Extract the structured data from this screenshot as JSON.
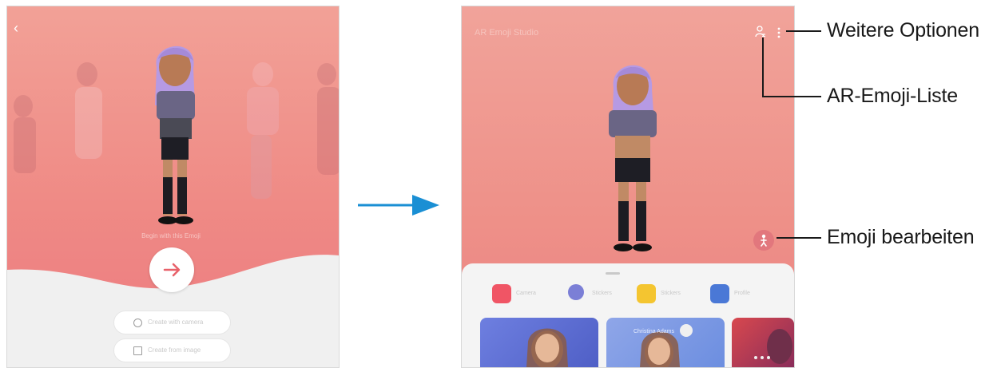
{
  "left_screen": {
    "back_label": "‹",
    "caption": "Begin with this Emoji",
    "next_button_label": "→",
    "options": [
      {
        "label": "Create with camera",
        "icon": "face-icon"
      },
      {
        "label": "Create from image",
        "icon": "image-icon"
      }
    ]
  },
  "right_screen": {
    "title": "AR Emoji Studio",
    "categories": [
      {
        "label": "Camera",
        "icon": "camera-icon",
        "color": "#f05565"
      },
      {
        "label": "Stickers",
        "icon": "studio-icon",
        "color": "#7b7fd6"
      },
      {
        "label": "Stickers",
        "icon": "sticker-icon",
        "color": "#f4c530"
      },
      {
        "label": "Profile",
        "icon": "profile-icon",
        "color": "#4a78d6"
      }
    ],
    "card_name": "Christina Adams"
  },
  "callouts": {
    "more_options": "Weitere Optionen",
    "emoji_list": "AR-Emoji-Liste",
    "edit_emoji": "Emoji bearbeiten"
  },
  "colors": {
    "arrow": "#1a8fd4",
    "edit_button": "#e2777d",
    "next_button_icon": "#e8616a"
  }
}
